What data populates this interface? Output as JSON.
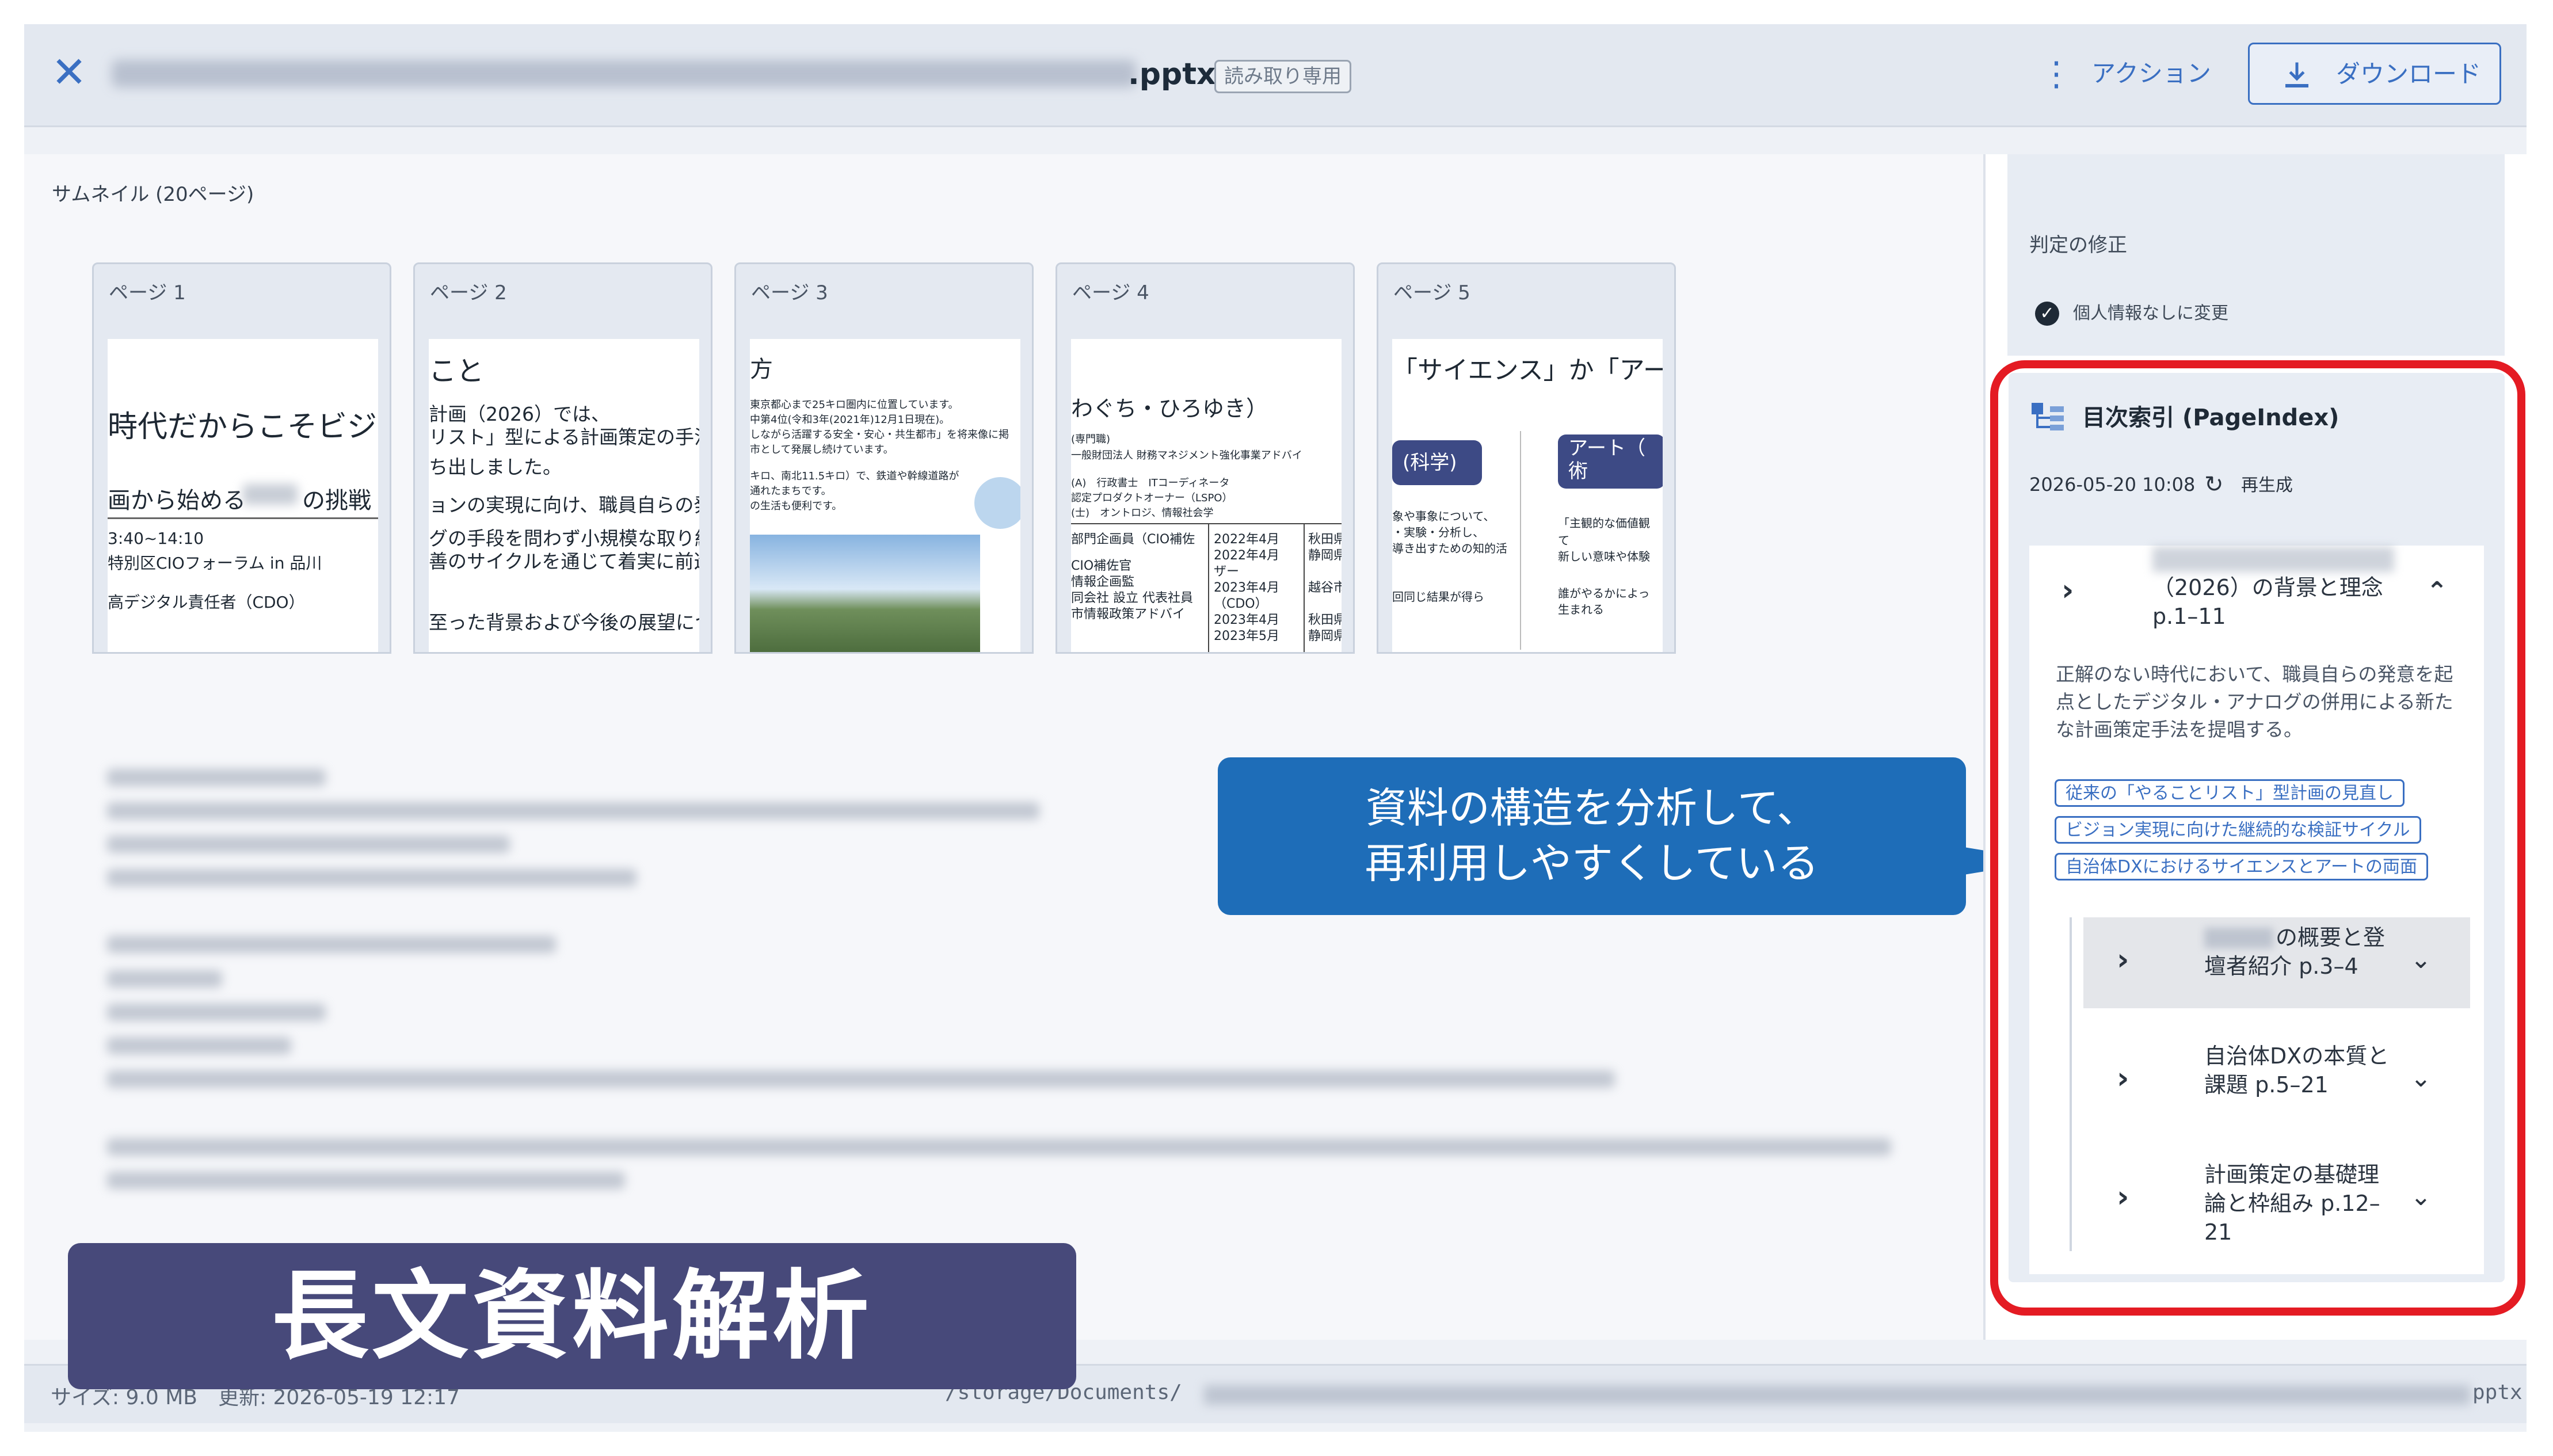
{
  "header": {
    "filename_ext": ".pptx",
    "readonly_badge": "読み取り専用",
    "action_label": "アクション",
    "download_label": "ダウンロード"
  },
  "thumbnails": {
    "title": "サムネイル (20ページ)",
    "pages": [
      {
        "label": "ページ 1",
        "lines": [
          "時代だからこそビジョ",
          "画から始める",
          "の挑戦",
          "3:40~14:10",
          "特別区CIOフォーラム in 品川",
          "高デジタル責任者（CDO）"
        ]
      },
      {
        "label": "ページ 2",
        "lines": [
          "こと",
          "計画（2026）では、",
          "リスト」型による計画策定の手法",
          "ち出しました。",
          "ョンの実現に向け、職員自らの発",
          "グの手段を問わず小規模な取り組",
          "善のサイクルを通じて着実に前進",
          "至った背景および今後の展望につ"
        ]
      },
      {
        "label": "ページ 3",
        "lines": [
          "方",
          "東京都心まで25キロ圏内に位置しています。",
          "中第4位(令和3年(2021年)12月1日現在)。",
          "しながら活躍する安全・安心・共生都市」を将来像に掲",
          "市として発展し続けています。",
          "キロ、南北11.5キロ）で、鉄道や幹線道路が",
          "通れたまちです。",
          "の生活も便利です。"
        ]
      },
      {
        "label": "ページ 4",
        "lines": [
          "わぐち・ひろゆき）",
          "(専門職)",
          "一般財団法人 財務マネジメント強化事業アドバイ",
          "(A)　行政書士　ITコーディネータ",
          "認定プロダクトオーナー（LSPO）",
          "(士)　オントロジ、情報社会学",
          "部門企画員（CIO補佐",
          "CIO補佐官",
          "情報企画監",
          "同会社 設立 代表社員",
          "市情報政策アドバイ",
          "2022年4月",
          "2022年4月",
          "ザー",
          "2023年4月",
          "（CDO）",
          "2023年4月",
          "2023年5月",
          "秋田県",
          "静岡県",
          "越谷市",
          "秋田県",
          "静岡県"
        ]
      },
      {
        "label": "ページ 5",
        "lines": [
          "「サイエンス」か「アー",
          "(科学)",
          "アート（",
          "術",
          "象や事象について、",
          "・実験・分析し、",
          "導き出すための知的活",
          "回同じ結果が得ら",
          "「主観的な価値観",
          "て",
          "新しい意味や体験",
          "誰がやるかによっ",
          "生まれる"
        ]
      }
    ]
  },
  "callout": {
    "line1": "資料の構造を分析して、",
    "line2": "再利用しやすくしている"
  },
  "banner": {
    "text": "長文資料解析"
  },
  "footer": {
    "size_text": "サイズ: 9.0 MB　更新: 2026-05-19 12:17",
    "path_prefix": "/storage/Documents/",
    "path_ext": "pptx"
  },
  "right": {
    "judge_title": "判定の修正",
    "judge_option": "個人情報なしに変更",
    "index_title": "目次索引 (PageIndex)",
    "index_date": "2026-05-20 10:08",
    "regenerate_label": "再生成",
    "section": {
      "title": "（2026）の背景と理念 p.1–11",
      "description": "正解のない時代において、職員自らの発意を起点としたデジタル・アナログの併用による新たな計画策定手法を提唱する。",
      "tags": [
        "従来の「やることリスト」型計画の見直し",
        "ビジョン実現に向けた継続的な検証サイクル",
        "自治体DXにおけるサイエンスとアートの両面"
      ]
    },
    "subsections": [
      {
        "title": "の概要と登壇者紹介 p.3–4"
      },
      {
        "title": "自治体DXの本質と課題 p.5–21"
      },
      {
        "title": "計画策定の基礎理論と枠組み p.12–21"
      }
    ]
  },
  "colors": {
    "accent": "#3a6fc2",
    "highlight_frame": "#e41b23",
    "callout_bg": "#1e6db8",
    "banner_bg": "#47497a"
  },
  "icons": [
    "close-icon",
    "kebab-menu-icon",
    "download-icon",
    "check-circle-icon",
    "tree-index-icon",
    "refresh-icon",
    "chevron-right-icon",
    "chevron-up-icon",
    "chevron-down-icon"
  ]
}
